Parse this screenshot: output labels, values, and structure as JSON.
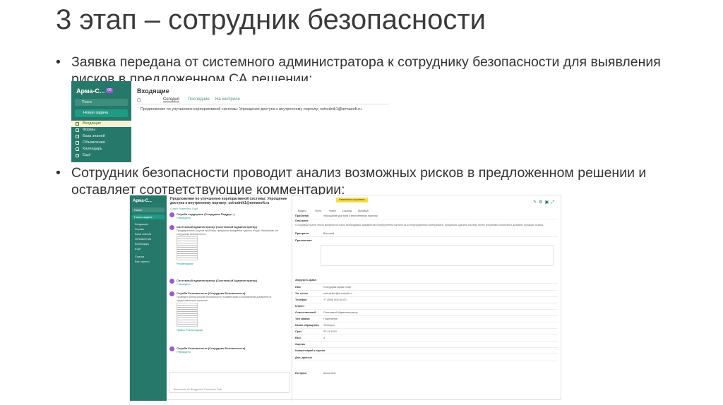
{
  "slide": {
    "title": "3 этап – сотрудник безопасности",
    "bullet_char": "•",
    "bullet1": "Заявка передана от системного администратора к сотруднику безопасности для выявления рисков в предложенном СА решении:",
    "bullet2": "Сотрудник безопасности проводит анализ возможных рисков в предложенном решении и оставляет соответствующие комментарии:"
  },
  "screenshot1": {
    "sidebar": {
      "logo": "Арма-С...",
      "badge": "08",
      "search_placeholder": "Поиск",
      "new_task": "Новая задача",
      "items": [
        "Входящие",
        "Формы",
        "База знаний",
        "Объявления",
        "Календарь",
        "Ещё"
      ]
    },
    "main": {
      "heading": "Входящие",
      "tabs": [
        "Сегодня",
        "Последние",
        "На контроле"
      ],
      "row": "Предложения по улучшению корпоративной системы: Упрощение доступа к внутреннему порталу; sotrudnik1@armasoft.ru"
    }
  },
  "screenshot2": {
    "sidebar": {
      "logo": "Арма-С...",
      "search": "Поиск",
      "new_task": "Новая задача",
      "items": [
        "Входящие",
        "Формы",
        "База знаний",
        "Объявления",
        "Календарь",
        "Ещё"
      ],
      "section": "Списки",
      "list_item": "Все записи"
    },
    "chat": {
      "title": "Предложения по улучшению корпоративной системы: Упрощение доступа к внутреннему порталу; sotrudnik1@armasoft.ru",
      "toolbar": "Ответ   Изменить   Ещё",
      "messages": [
        {
          "name": "Служба поддержки (Сотрудник Поддер...)",
          "text": "",
          "tag": "Утверждено"
        },
        {
          "name": "Системный администратор (Системный Администратор)",
          "text": "Предварительно изучив проблему, предлагаю внедрение единого входа. Направляю это сотруднику безопасности.",
          "tag": "Рекомендации"
        },
        {
          "name": "Системный администратор (Системный Администратор)",
          "text": "",
          "tag": "Утверждено"
        },
        {
          "name": "Служба безопасности (Сотрудник Безопасности)",
          "text": "Проведен анализ рисков безопасности. Комментарии и исправления добавлены в предоставленное решение.",
          "tag": "Правки. Рекомендации"
        },
        {
          "name": "Служба безопасности (Сотрудник Безопасности)",
          "text": "",
          "tag": "Утверждено"
        }
      ],
      "footer": "Выполнить на Внедрение   Отклонить   Ещё"
    },
    "form": {
      "status_tag": "Изменения сохранены",
      "toolbar": [
        "Видео",
        "Фото",
        "Файл",
        "Ссылка",
        "Таблица"
      ],
      "fields": [
        {
          "label": "Проблема",
          "value": "Упрощение доступа к внутреннему порталу"
        },
        {
          "label": "Описание",
          "value": ""
        },
        {
          "label": "Приоритет",
          "value": "Высокий"
        },
        {
          "label": "Приложения",
          "value": ""
        }
      ],
      "description": "Сотрудники тратят много времени на поиск необходимых документов на внутреннем портале из-за перегруженного интерфейса. Предлагаю сделать систему более интуитивно понятной и добавить функцию поиска.",
      "contact_fields": [
        {
          "label": "Загрузить файл",
          "value": ""
        },
        {
          "label": "Имя",
          "value": "Сотрудник Арма Софт"
        },
        {
          "label": "Эл. почта",
          "value": "sotrudnik1@armasoft.ru"
        },
        {
          "label": "Телефон",
          "value": "+7 (900) 000-00-00"
        },
        {
          "label": "Клиент",
          "value": ""
        },
        {
          "label": "Ответственный",
          "value": "Системный Администратор"
        },
        {
          "label": "Тип заявки",
          "value": "Пожелание"
        },
        {
          "label": "Канал обращения",
          "value": "Телефон"
        },
        {
          "label": "Срок",
          "value": "29.11.2024"
        },
        {
          "label": "Выз",
          "value": "4"
        },
        {
          "label": "Оценка",
          "value": ""
        },
        {
          "label": "Комментарий к оценке",
          "value": ""
        },
        {
          "label": "Доп. данные",
          "value": ""
        }
      ],
      "history_label": "История",
      "history_value": "Ассистент"
    }
  }
}
